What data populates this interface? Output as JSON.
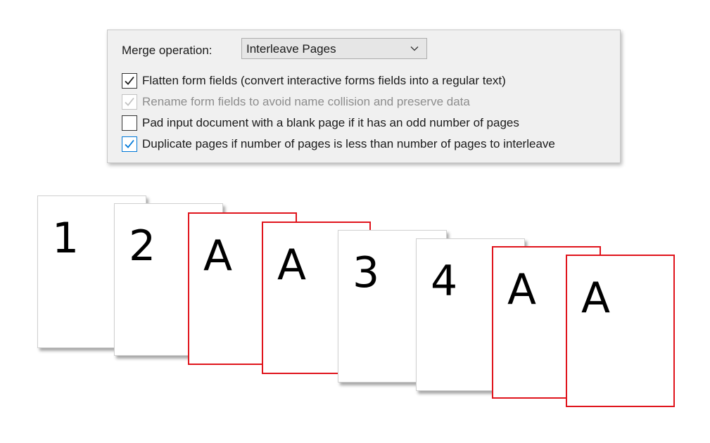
{
  "merge": {
    "label": "Merge operation:",
    "selected": "Interleave Pages"
  },
  "options": [
    {
      "label": "Flatten form fields (convert interactive forms fields into a regular text)",
      "checked": true,
      "disabled": false,
      "style": "dark"
    },
    {
      "label": "Rename form fields to avoid name collision and preserve data",
      "checked": true,
      "disabled": true,
      "style": "disabled"
    },
    {
      "label": "Pad input document with a blank page if it has an odd number of pages",
      "checked": false,
      "disabled": false,
      "style": "dark"
    },
    {
      "label": "Duplicate pages if number of pages is less than number of pages to interleave",
      "checked": true,
      "disabled": false,
      "style": "accent"
    }
  ],
  "pages": [
    {
      "label": "1",
      "source": "input",
      "border_color": "#d0d0d0"
    },
    {
      "label": "2",
      "source": "input",
      "border_color": "#d0d0d0"
    },
    {
      "label": "A",
      "source": "interleave",
      "border_color": "#e0141c"
    },
    {
      "label": "A",
      "source": "interleave",
      "border_color": "#e0141c"
    },
    {
      "label": "3",
      "source": "input",
      "border_color": "#d0d0d0"
    },
    {
      "label": "4",
      "source": "input",
      "border_color": "#d0d0d0"
    },
    {
      "label": "A",
      "source": "interleave",
      "border_color": "#e0141c"
    },
    {
      "label": "A",
      "source": "interleave",
      "border_color": "#e0141c"
    }
  ],
  "colors": {
    "check_dark": "#1a1a1a",
    "check_accent": "#0078d7",
    "check_disabled": "#c2c2c2",
    "interleave_border": "#e0141c"
  },
  "icons": {
    "dropdown": "chevron-down-icon",
    "check": "checkmark-icon"
  }
}
